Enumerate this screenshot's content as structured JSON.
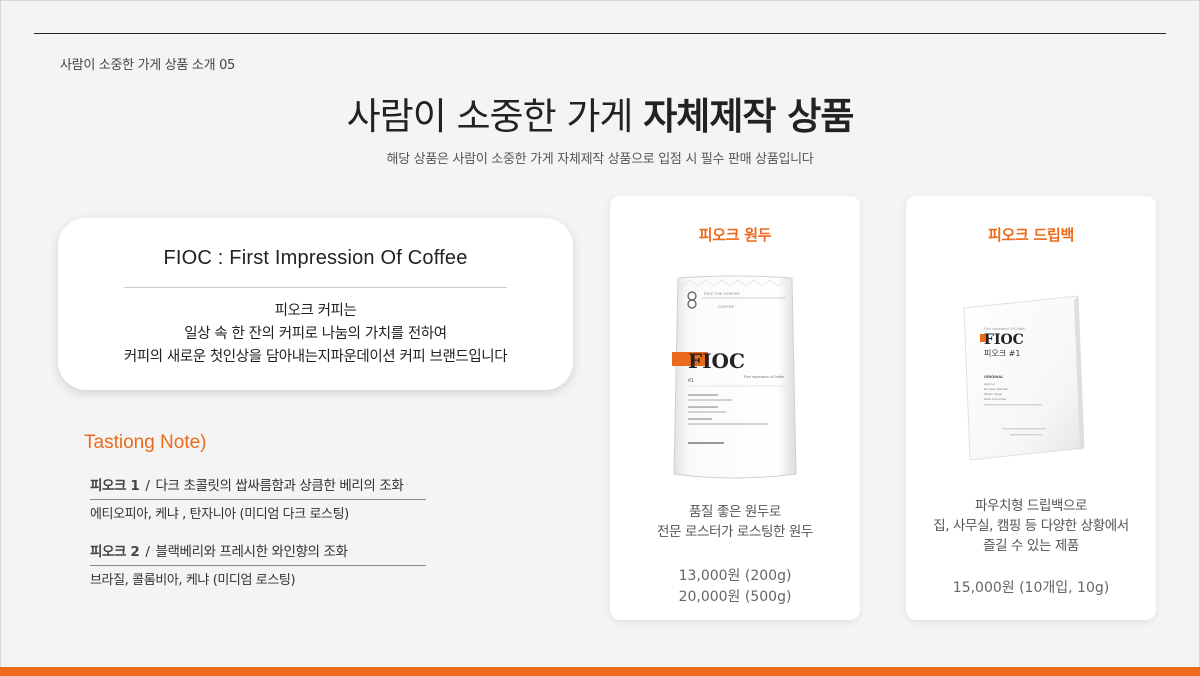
{
  "header": {
    "section_label": "사람이 소중한 가게 상품 소개  05",
    "title_regular": "사람이 소중한 가게 ",
    "title_bold": "자체제작 상품",
    "subtitle": "해당 상품은 사람이 소중한 가게 자체제작 상품으로 입점 시 필수 판매 상품입니다"
  },
  "intro": {
    "title": "FIOC : First  Impression  Of  Coffee",
    "lines": [
      "피오크 커피는",
      "일상 속 한 잔의 커피로 나눔의 가치를 전하여",
      "커피의 새로운 첫인상을 담아내는지파운데이션 커피 브랜드입니다"
    ]
  },
  "tasting": {
    "heading": "Tastiong Note)",
    "notes": [
      {
        "name": "피오크 1",
        "slash": "/",
        "desc": "다크 초콜릿의 쌉싸름함과 상큼한 베리의 조화",
        "origin": "에티오피아, 케냐 , 탄자니아 (미디엄 다크 로스팅)"
      },
      {
        "name": "피오크 2",
        "slash": "/",
        "desc": "블랙베리와 프레시한 와인향의 조화",
        "origin": "브라질, 콜롬비아, 케냐 (미디엄 로스팅)"
      }
    ]
  },
  "products": [
    {
      "title": "피오크 원두",
      "desc": [
        "품질 좋은 원두로",
        "전문 로스터가 로스팅한 원두"
      ],
      "prices": [
        "13,000원 (200g)",
        "20,000원 (500g)"
      ],
      "package": {
        "brand": "FIOC",
        "number": "#1",
        "side_text": "First Impression of Coffee",
        "small_text": "FIOC THE COFFEE",
        "tag": "COFFEE"
      }
    },
    {
      "title": "피오크 드립백",
      "desc": [
        "파우치형 드립백으로",
        "집, 사무실, 캠핑 등 다양한 상황에서",
        "즐길 수 있는 제품"
      ],
      "prices": [
        "15,000원 (10개입, 10g)"
      ],
      "package": {
        "brand": "FIOC",
        "subname": "피오크 #1",
        "small_text": "First Impression Of Coffee",
        "notes_title": "ORIGINAL",
        "notes": [
          "Apricot",
          "Roasted Almond",
          "Maple Syrup",
          "Dark Chocolate"
        ]
      }
    }
  ],
  "colors": {
    "accent": "#ec6a1b",
    "bottom_bar": "#ef6c1d",
    "background": "#f4f4f4"
  }
}
